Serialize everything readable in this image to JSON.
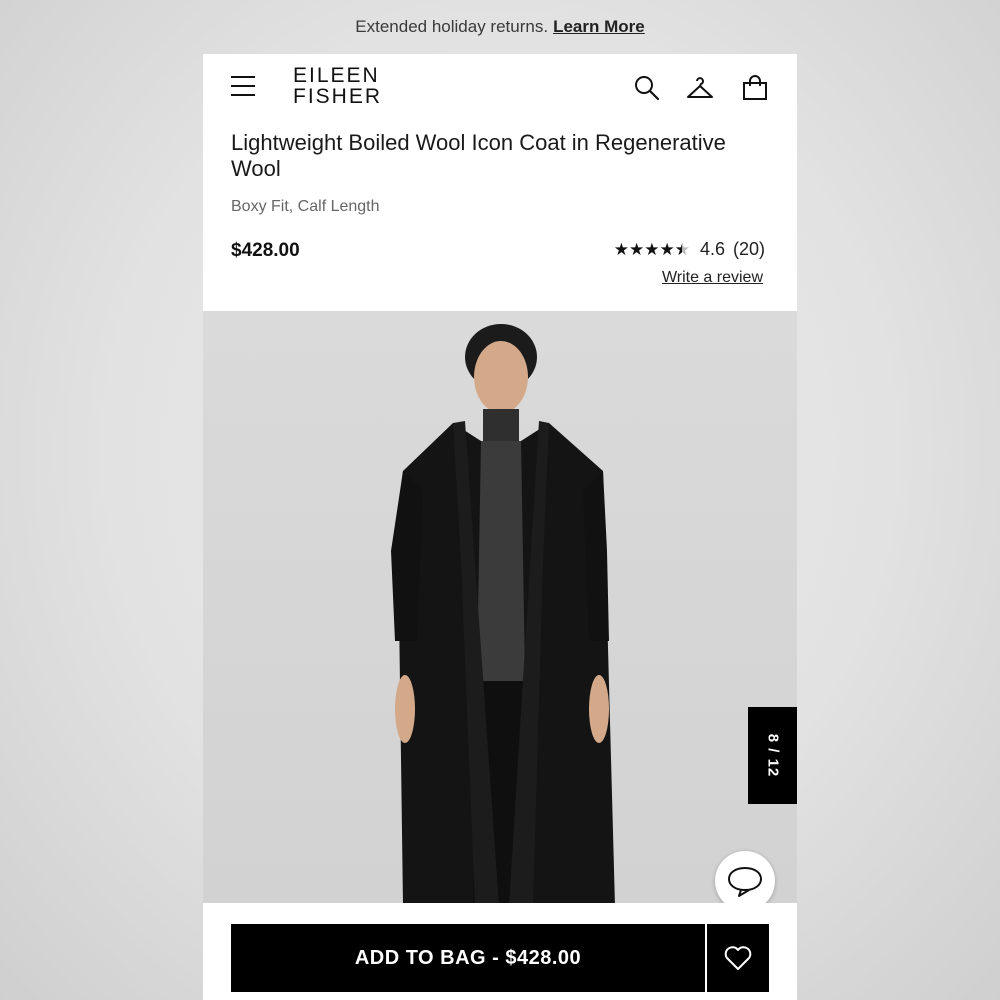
{
  "promo": {
    "text": "Extended holiday returns.",
    "link": "Learn More"
  },
  "header": {
    "logo_line1": "EILEEN",
    "logo_line2": "FISHER",
    "icons": [
      "menu-icon",
      "search-icon",
      "account-hanger-icon",
      "shopping-bag-icon"
    ]
  },
  "product": {
    "title": "Lightweight Boiled Wool Icon Coat in Regenerative Wool",
    "subtitle": "Boxy Fit, Calf Length",
    "price": "$428.00",
    "rating": 4.6,
    "rating_text": "4.6",
    "review_count": "(20)",
    "write_review": "Write a review"
  },
  "gallery": {
    "counter": "8 / 12",
    "current": 8,
    "total": 12
  },
  "actions": {
    "add_to_bag": "ADD TO BAG - $428.00"
  },
  "colors": {
    "background": "#ffffff",
    "button": "#000000",
    "image_bg": "#d8d8d8",
    "coat": "#141414",
    "top": "#3a3a3a"
  }
}
